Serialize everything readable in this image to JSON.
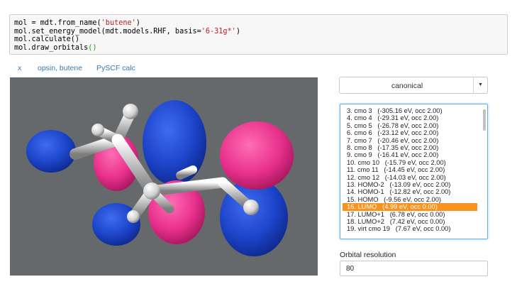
{
  "code_lines": [
    [
      {
        "t": "mol = mdt.from_name("
      },
      {
        "t": "'butene'",
        "c": "str"
      },
      {
        "t": ")"
      }
    ],
    [
      {
        "t": "mol.set_energy_model(mdt.models.RHF, basis="
      },
      {
        "t": "'6-31g*'",
        "c": "str"
      },
      {
        "t": ")"
      }
    ],
    [
      {
        "t": "mol.calculate()"
      }
    ],
    [
      {
        "t": "mol.draw_orbitals"
      },
      {
        "t": "()",
        "c": "par"
      }
    ]
  ],
  "tabs": [
    "x",
    "opsin, butene",
    "PySCF calc"
  ],
  "viewer": {
    "background": "#66696c",
    "positive_color": "#ee2f8d",
    "negative_color": "#1c44c9"
  },
  "orbital_type": {
    "selected": "canonical"
  },
  "orbital_list": {
    "selected_index": 13,
    "items": [
      "3. cmo 3   (-305.16 eV, occ 2.00)",
      "4. cmo 4   (-29.31 eV, occ 2.00)",
      "5. cmo 5   (-26.78 eV, occ 2.00)",
      "6. cmo 6   (-23.12 eV, occ 2.00)",
      "7. cmo 7   (-20.46 eV, occ 2.00)",
      "8. cmo 8   (-17.35 eV, occ 2.00)",
      "9. cmo 9   (-16.41 eV, occ 2.00)",
      "10. cmo 10   (-15.79 eV, occ 2.00)",
      "11. cmo 11   (-14.45 eV, occ 2.00)",
      "12. cmo 12   (-14.03 eV, occ 2.00)",
      "13. HOMO-2   (-13.09 eV, occ 2.00)",
      "14. HOMO-1   (-12.82 eV, occ 2.00)",
      "15. HOMO   (-9.56 eV, occ 2.00)",
      "16. LUMO   (4.99 eV, occ 0.00)",
      "17. LUMO+1   (6.78 eV, occ 0.00)",
      "18. LUMO+2   (7.42 eV, occ 0.00)",
      "19. virt cmo 19   (7.67 eV, occ 0.00)"
    ]
  },
  "resolution": {
    "label": "Orbital resolution",
    "value": "80"
  }
}
